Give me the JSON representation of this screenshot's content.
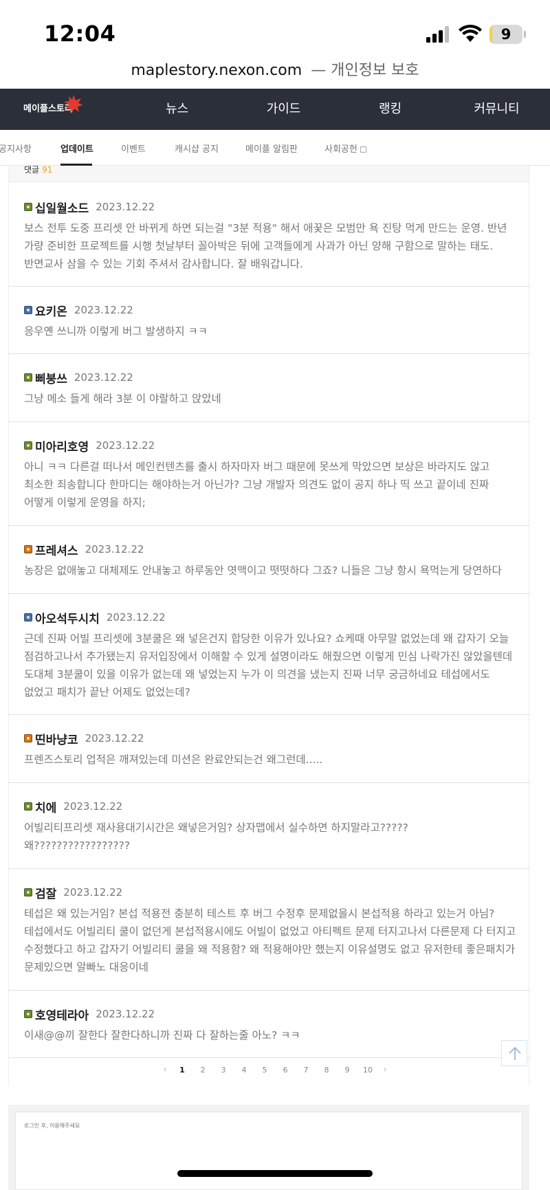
{
  "status_bar": {
    "time": "12:04",
    "battery_level": "9",
    "battery_fraction": 0.09,
    "icons": [
      "signal-icon",
      "wifi-icon",
      "battery-icon"
    ]
  },
  "browser": {
    "domain": "maplestory.nexon.com",
    "privacy_label": "— 개인정보 보호"
  },
  "site_header": {
    "logo_text": "메이플스토리",
    "nav": [
      "뉴스",
      "가이드",
      "랭킹",
      "커뮤니티"
    ],
    "colors": {
      "header_bg": "#2a2f3a",
      "logo_leaf": "#e53b2c"
    }
  },
  "sub_nav": {
    "items": [
      "공지사항",
      "업데이트",
      "이벤트",
      "캐시샵 공지",
      "메이플 알림판",
      "사회공헌"
    ],
    "active": "업데이트"
  },
  "comments_header": {
    "label": "댓글",
    "count": "91"
  },
  "comments": [
    {
      "name": "십일월소드",
      "date": "2023.12.22",
      "badge": "green",
      "text": "보스 전투 도중 프리셋 안 바뀌게 하면 되는걸 \"3분 적용\" 해서 애꿎은 모범만 욕 진탕 먹게 만드는 운영. 반년 가량 준비한 프로젝트를 시행 첫날부터 꼴아박은 뒤에 고객들에게 사과가 아닌 양해 구함으로 말하는 태도. 반면교사 삼을 수 있는 기회 주셔서 감사합니다. 잘 배워갑니다."
    },
    {
      "name": "요키온",
      "date": "2023.12.22",
      "badge": "blue",
      "text": "응우옌 쓰니까 이렇게 버그 발생하지 ㅋㅋ"
    },
    {
      "name": "삐붕쓰",
      "date": "2023.12.22",
      "badge": "green",
      "text": "그냥 메소 들게 해라 3분 이 야랄하고 앉았네"
    },
    {
      "name": "미아리호영",
      "date": "2023.12.22",
      "badge": "green",
      "text": "아니 ㅋㅋ 다른걸 떠나서 메인컨텐츠를 출시 하자마자 버그 때문에 못쓰게 막았으면 보상은 바라지도 않고 최소한 죄송합니다 한마디는 해야하는거 아닌가? 그냥 개발자 의견도 없이 공지 하나 띡 쓰고 끝이네 진짜 어떻게 이렇게 운영을 하지;"
    },
    {
      "name": "프레셔스",
      "date": "2023.12.22",
      "badge": "orange",
      "text": "농장은 없애놓고 대체제도 안내놓고 하루동안 엿맥이고 떳떳하다 그죠? 니들은 그냥 항시 욕먹는게 당연하다"
    },
    {
      "name": "아오석두시치",
      "date": "2023.12.22",
      "badge": "blue",
      "text": "근데 진짜 어빌 프리셋에 3분쿨은 왜 넣은건지 합당한 이유가 있나요? 쇼케때 아무말 없었는데 왜 갑자기 오늘 점검하고나서 추가됐는지 유저입장에서 이해할 수 있게 설명이라도 해줬으면 이렇게 민심 나락가진 않았을텐데 도대체 3분쿨이 있을 이유가 없는데 왜 넣었는지 누가 이 의견을 냈는지 진짜 너무 궁금하네요 테섭에서도 없었고 패치가 끝난 어제도 없었는데?"
    },
    {
      "name": "띤바냥코",
      "date": "2023.12.22",
      "badge": "orange",
      "text": "프렌즈스토리 업적은 깨져있는데 미션은 완료안되는건 왜그런데....."
    },
    {
      "name": "치에",
      "date": "2023.12.22",
      "badge": "green",
      "text": "어빌리티프리셋 재사용대기시간은 왜넣은거임? 상자맵에서 실수하면 하지말라고?????왜?????????????????"
    },
    {
      "name": "검잘",
      "date": "2023.12.22",
      "badge": "green",
      "text": "테섭은 왜 있는거임? 본섭 적용전 충분히 테스트 후 버그 수정후 문제없을시 본섭적용 하라고 있는거 아님? 테섭에서도 어빌리티 쿨이 없던게 본섭적용시에도 어빌이 없었고 아티펙트 문제 터지고나서 다른문제 다 터지고 수정했다고 하고 갑자기 어빌리티 쿨을 왜 적용함? 왜 적용해야만 했는지 이유설명도 없고 유저한테 좋은패치가 문제있으면 알빠노 대응이네"
    },
    {
      "name": "호영테라아",
      "date": "2023.12.22",
      "badge": "green",
      "text": "이새@@끼 잘한다 잘한다하니까 진짜 다 잘하는줄 아노? ㅋㅋ"
    }
  ],
  "pagination": {
    "prev": "‹",
    "pages": [
      "1",
      "2",
      "3",
      "4",
      "5",
      "6",
      "7",
      "8",
      "9",
      "10"
    ],
    "current": "1",
    "next": "›"
  },
  "comment_input": {
    "placeholder": "로그인 후, 이용해주세요"
  }
}
